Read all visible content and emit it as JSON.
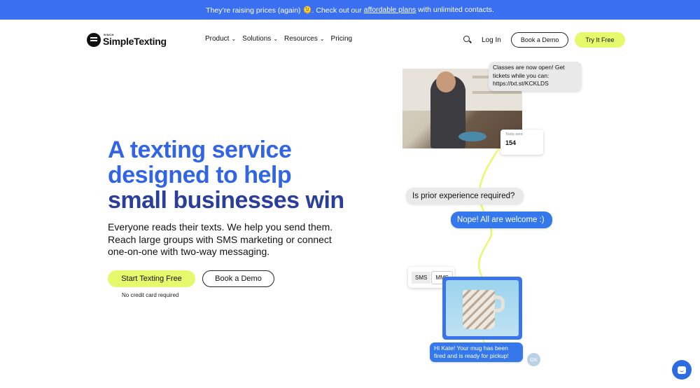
{
  "banner": {
    "text_before": "They’re raising prices (again) 🫠. Check out our",
    "link": "affordable plans",
    "text_after": "with unlimited contacts."
  },
  "logo": {
    "small": "SINCH",
    "name": "SimpleTexting"
  },
  "nav": {
    "items": [
      {
        "label": "Product",
        "has_chevron": true
      },
      {
        "label": "Solutions",
        "has_chevron": true
      },
      {
        "label": "Resources",
        "has_chevron": true
      },
      {
        "label": "Pricing",
        "has_chevron": false
      }
    ],
    "chevron": "⌄",
    "login": "Log In",
    "book_demo": "Book a Demo",
    "try_free": "Try It Free"
  },
  "hero": {
    "title_line1": "A texting service",
    "title_line2": "designed to help",
    "title_line3": "small businesses win",
    "subtitle": "Everyone reads their texts. We help you send them. Reach large groups with SMS marketing or connect one-on-one with two-way messaging.",
    "cta_primary": "Start Texting Free",
    "cta_secondary": "Book a Demo",
    "note": "No credit card required"
  },
  "illustration": {
    "class_message": "Classes are now open! Get tickets while you can: https://txt.st/KCKLDS",
    "texts_sent_label": "Texts sent",
    "texts_sent_value": "154",
    "question": "Is prior experience required?",
    "answer": "Nope! All are welcome :)",
    "toggle_sms": "SMS",
    "toggle_mms": "MMS",
    "kate_message": "Hi Kate! Your mug has been fired and is ready for pickup!",
    "avatar_initials": "GK"
  },
  "colors": {
    "banner": "#3a6ff0",
    "accent_lime": "#e4f96b",
    "title_blue": "#3265e6",
    "title_dark_blue": "#2a3f9c",
    "bubble_blue": "#3578ec"
  }
}
